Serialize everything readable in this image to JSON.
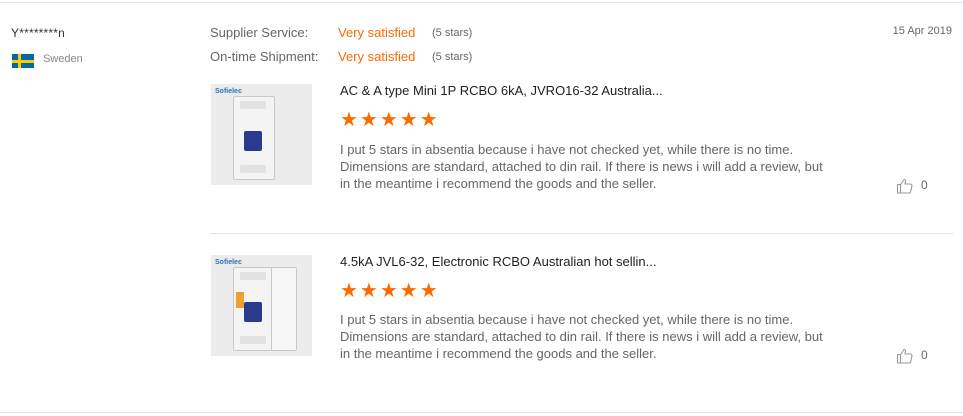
{
  "reviewer": {
    "name": "Y********n",
    "country": "Sweden",
    "flag": "sweden-flag"
  },
  "date": "15 Apr 2019",
  "ratings": [
    {
      "label": "Supplier Service:",
      "value": "Very satisfied",
      "stars": "(5 stars)"
    },
    {
      "label": "On-time Shipment:",
      "value": "Very satisfied",
      "stars": "(5 stars)"
    }
  ],
  "reviews": [
    {
      "image_logo": "Sofielec",
      "title": "AC & A type Mini 1P RCBO 6kA, JVRO16-32 Australia...",
      "stars": "★★★★★",
      "rating": 5,
      "text": "I put 5 stars in absentia because i have not checked yet, while there is no time. Dimensions are standard, attached to din rail. If there is news i will add a review, but in the meantime i recommend the goods and the seller.",
      "likes": "0"
    },
    {
      "image_logo": "Sofielec",
      "title": "4.5kA JVL6-32, Electronic RCBO Australian hot sellin...",
      "stars": "★★★★★",
      "rating": 5,
      "text": "I put 5 stars in absentia because i have not checked yet, while there is no time. Dimensions are standard, attached to din rail. If there is news i will add a review, but in the meantime i recommend the goods and the seller.",
      "likes": "0"
    }
  ],
  "colors": {
    "accent": "#ff6a00",
    "muted_text": "#666666",
    "divider": "#e4e4e4"
  }
}
